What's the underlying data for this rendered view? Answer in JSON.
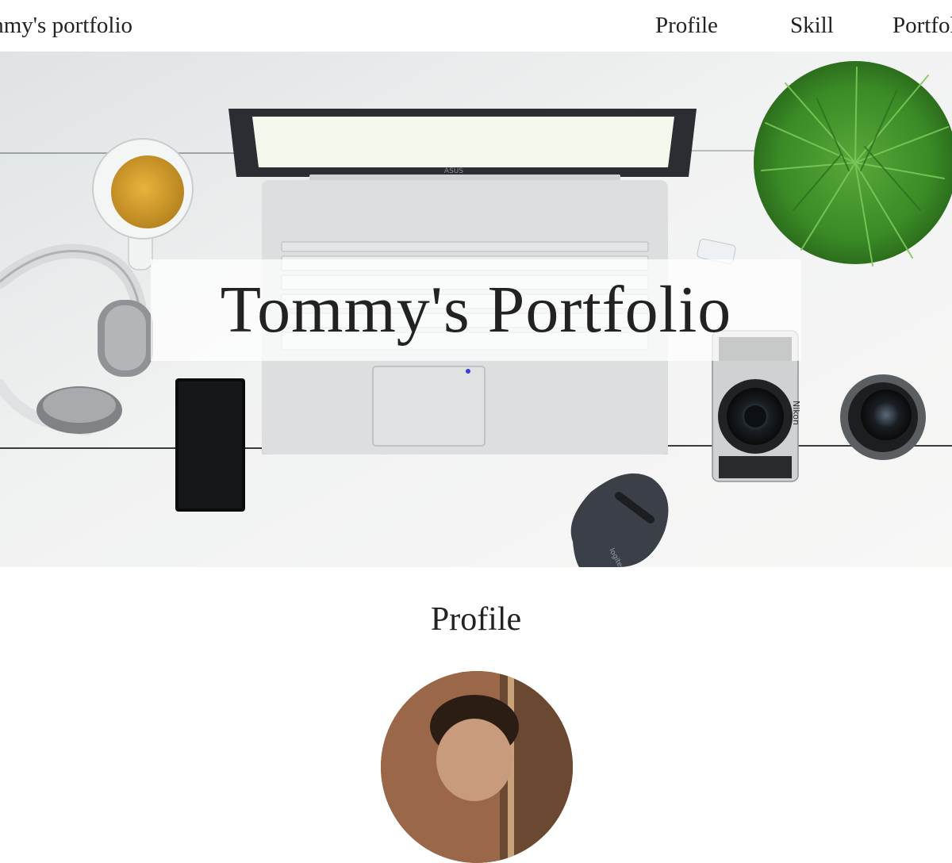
{
  "header": {
    "logo_text": "Tommy's portfolio",
    "nav": [
      {
        "label": "Profile"
      },
      {
        "label": "Skill"
      },
      {
        "label": "Portfolio"
      }
    ]
  },
  "hero": {
    "title": "Tommy's Portfolio",
    "laptop_brand": "ASUS",
    "camera_brand": "Nikon",
    "mouse_brand": "logitech"
  },
  "profile": {
    "section_title": "Profile"
  },
  "colors": {
    "text": "#222222",
    "background": "#ffffff",
    "desk": "#eef0f0",
    "plant": "#3f8f2a"
  }
}
